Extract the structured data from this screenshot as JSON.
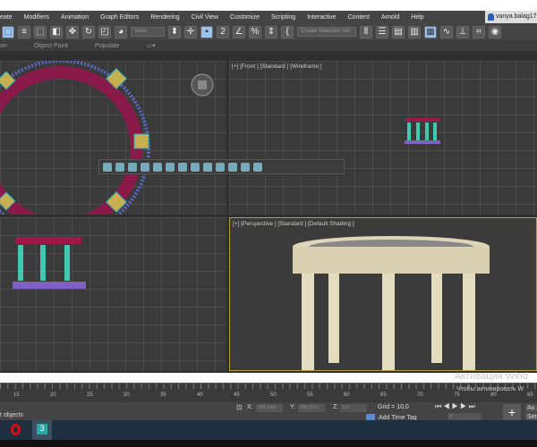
{
  "menu": [
    "eate",
    "Modifiers",
    "Animation",
    "Graph Editors",
    "Rendering",
    "Civil View",
    "Customize",
    "Scripting",
    "Interactive",
    "Content",
    "Arnold",
    "Help"
  ],
  "user": "vanya.balag17",
  "toolbar": {
    "view_dropdown": "View",
    "selection_set": "Create Selection Set"
  },
  "ribbon": [
    "on",
    "Object Paint",
    "Populate"
  ],
  "viewports": {
    "front": "[+] [Front ] [Standard ] [Wireframe ]",
    "perspective": "[+] [Perspective ] [Standard ] [Default Shading ]"
  },
  "timeline_ticks": [
    "15",
    "20",
    "25",
    "30",
    "35",
    "40",
    "45",
    "50",
    "55",
    "60",
    "65",
    "70",
    "75",
    "80",
    "85"
  ],
  "status": {
    "prompt": "t objects",
    "x_label": "X:",
    "x": "286,646",
    "y_label": "Y:",
    "y": "245,873",
    "z_label": "Z:",
    "z": "0,0",
    "grid": "Grid = 10,0",
    "add_time_tag": "Add Time Tag",
    "frame": "0",
    "auto": "Au",
    "set": "Set"
  },
  "watermark": {
    "title": "Активация Wind",
    "line": "Чтобы активировать W"
  },
  "colors": {
    "accent": "#9ac3ee",
    "active_viewport": "#b8a035"
  }
}
